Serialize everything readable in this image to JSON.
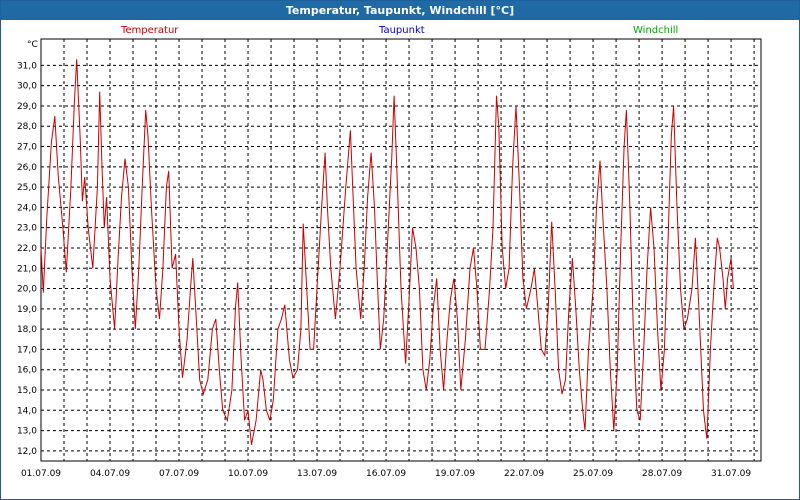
{
  "window": {
    "title": "Temperatur, Taupunkt, Windchill [°C]"
  },
  "colors": {
    "titlebar": "#1f6aa5",
    "temperatur": "#cc0000",
    "taupunkt": "#0000cc",
    "windchill": "#00aa00",
    "grid": "#000000"
  },
  "chart_data": {
    "type": "line",
    "title": "Temperatur, Taupunkt, Windchill [°C]",
    "ylabel": "°C",
    "xlabel": "",
    "ylim": [
      11.5,
      32.3
    ],
    "xlim": [
      0,
      31.3
    ],
    "grid": true,
    "legend_placement": "top",
    "legend": [
      "Temperatur",
      "Taupunkt",
      "Windchill"
    ],
    "y_ticks": [
      "12,0",
      "13,0",
      "14,0",
      "15,0",
      "16,0",
      "17,0",
      "18,0",
      "19,0",
      "20,0",
      "21,0",
      "22,0",
      "23,0",
      "24,0",
      "25,0",
      "26,0",
      "27,0",
      "28,0",
      "29,0",
      "30,0",
      "31,0"
    ],
    "x_ticks": [
      {
        "day": 0,
        "label": "01.07.09"
      },
      {
        "day": 3,
        "label": "04.07.09"
      },
      {
        "day": 6,
        "label": "07.07.09"
      },
      {
        "day": 9,
        "label": "10.07.09"
      },
      {
        "day": 12,
        "label": "13.07.09"
      },
      {
        "day": 15,
        "label": "16.07.09"
      },
      {
        "day": 18,
        "label": "19.07.09"
      },
      {
        "day": 21,
        "label": "22.07.09"
      },
      {
        "day": 24,
        "label": "25.07.09"
      },
      {
        "day": 27,
        "label": "28.07.09"
      },
      {
        "day": 30,
        "label": "31.07.09"
      }
    ],
    "series": [
      {
        "name": "Temperatur",
        "points": [
          [
            0.0,
            22.0
          ],
          [
            0.1,
            19.8
          ],
          [
            0.25,
            23.5
          ],
          [
            0.45,
            27.2
          ],
          [
            0.6,
            28.5
          ],
          [
            0.75,
            25.5
          ],
          [
            0.95,
            23.0
          ],
          [
            1.1,
            20.8
          ],
          [
            1.3,
            25.0
          ],
          [
            1.45,
            29.2
          ],
          [
            1.55,
            31.3
          ],
          [
            1.7,
            27.5
          ],
          [
            1.8,
            24.3
          ],
          [
            1.9,
            25.5
          ],
          [
            2.05,
            23.0
          ],
          [
            2.25,
            21.0
          ],
          [
            2.45,
            25.0
          ],
          [
            2.55,
            29.7
          ],
          [
            2.65,
            26.0
          ],
          [
            2.75,
            23.0
          ],
          [
            2.85,
            24.5
          ],
          [
            3.0,
            20.5
          ],
          [
            3.2,
            18.0
          ],
          [
            3.35,
            21.5
          ],
          [
            3.5,
            24.5
          ],
          [
            3.65,
            26.4
          ],
          [
            3.8,
            25.0
          ],
          [
            3.95,
            21.0
          ],
          [
            4.1,
            18.0
          ],
          [
            4.25,
            21.0
          ],
          [
            4.4,
            25.0
          ],
          [
            4.55,
            28.8
          ],
          [
            4.65,
            27.5
          ],
          [
            4.8,
            24.0
          ],
          [
            5.0,
            20.0
          ],
          [
            5.15,
            18.5
          ],
          [
            5.3,
            21.0
          ],
          [
            5.45,
            25.0
          ],
          [
            5.55,
            25.8
          ],
          [
            5.7,
            21.0
          ],
          [
            5.85,
            21.7
          ],
          [
            6.0,
            18.0
          ],
          [
            6.15,
            15.6
          ],
          [
            6.35,
            17.5
          ],
          [
            6.5,
            20.0
          ],
          [
            6.6,
            21.5
          ],
          [
            6.75,
            18.5
          ],
          [
            6.9,
            15.5
          ],
          [
            7.05,
            14.8
          ],
          [
            7.25,
            15.5
          ],
          [
            7.45,
            18.0
          ],
          [
            7.6,
            18.5
          ],
          [
            7.75,
            16.0
          ],
          [
            7.9,
            14.0
          ],
          [
            8.1,
            13.5
          ],
          [
            8.3,
            15.0
          ],
          [
            8.45,
            19.0
          ],
          [
            8.55,
            20.3
          ],
          [
            8.7,
            16.5
          ],
          [
            8.85,
            13.5
          ],
          [
            9.0,
            14.0
          ],
          [
            9.15,
            12.3
          ],
          [
            9.35,
            13.5
          ],
          [
            9.55,
            16.0
          ],
          [
            9.65,
            15.5
          ],
          [
            9.8,
            14.0
          ],
          [
            9.95,
            13.5
          ],
          [
            10.1,
            14.5
          ],
          [
            10.3,
            18.0
          ],
          [
            10.45,
            18.5
          ],
          [
            10.6,
            19.2
          ],
          [
            10.8,
            16.5
          ],
          [
            10.95,
            15.6
          ],
          [
            11.15,
            16.0
          ],
          [
            11.3,
            18.0
          ],
          [
            11.4,
            23.2
          ],
          [
            11.55,
            20.0
          ],
          [
            11.7,
            17.0
          ],
          [
            11.85,
            17.0
          ],
          [
            12.0,
            20.0
          ],
          [
            12.2,
            24.0
          ],
          [
            12.35,
            26.7
          ],
          [
            12.45,
            24.0
          ],
          [
            12.6,
            21.0
          ],
          [
            12.8,
            18.5
          ],
          [
            13.0,
            21.0
          ],
          [
            13.25,
            25.0
          ],
          [
            13.45,
            27.8
          ],
          [
            13.55,
            25.0
          ],
          [
            13.7,
            21.0
          ],
          [
            13.9,
            18.5
          ],
          [
            14.05,
            21.0
          ],
          [
            14.2,
            24.5
          ],
          [
            14.35,
            26.7
          ],
          [
            14.5,
            24.0
          ],
          [
            14.6,
            21.0
          ],
          [
            14.75,
            17.0
          ],
          [
            14.9,
            18.5
          ],
          [
            15.1,
            23.0
          ],
          [
            15.25,
            26.5
          ],
          [
            15.35,
            29.5
          ],
          [
            15.5,
            25.0
          ],
          [
            15.65,
            20.0
          ],
          [
            15.85,
            16.3
          ],
          [
            16.0,
            19.5
          ],
          [
            16.15,
            23.0
          ],
          [
            16.3,
            22.0
          ],
          [
            16.45,
            20.0
          ],
          [
            16.6,
            16.0
          ],
          [
            16.75,
            15.0
          ],
          [
            16.9,
            16.5
          ],
          [
            17.05,
            19.0
          ],
          [
            17.2,
            20.5
          ],
          [
            17.35,
            17.0
          ],
          [
            17.5,
            15.0
          ],
          [
            17.65,
            17.5
          ],
          [
            17.8,
            19.5
          ],
          [
            17.95,
            20.5
          ],
          [
            18.1,
            18.5
          ],
          [
            18.25,
            15.0
          ],
          [
            18.45,
            17.5
          ],
          [
            18.65,
            21.0
          ],
          [
            18.8,
            22.0
          ],
          [
            18.95,
            20.0
          ],
          [
            19.1,
            17.0
          ],
          [
            19.3,
            17.0
          ],
          [
            19.5,
            20.0
          ],
          [
            19.65,
            23.0
          ],
          [
            19.8,
            29.5
          ],
          [
            19.9,
            28.0
          ],
          [
            20.05,
            22.0
          ],
          [
            20.2,
            20.0
          ],
          [
            20.35,
            21.0
          ],
          [
            20.5,
            26.0
          ],
          [
            20.65,
            29.0
          ],
          [
            20.8,
            25.0
          ],
          [
            20.95,
            20.5
          ],
          [
            21.1,
            19.0
          ],
          [
            21.3,
            20.0
          ],
          [
            21.45,
            21.0
          ],
          [
            21.6,
            19.0
          ],
          [
            21.75,
            17.0
          ],
          [
            21.9,
            16.7
          ],
          [
            22.05,
            19.0
          ],
          [
            22.2,
            23.3
          ],
          [
            22.35,
            20.0
          ],
          [
            22.5,
            16.0
          ],
          [
            22.65,
            14.8
          ],
          [
            22.8,
            15.5
          ],
          [
            22.95,
            19.0
          ],
          [
            23.1,
            21.5
          ],
          [
            23.25,
            19.0
          ],
          [
            23.4,
            16.0
          ],
          [
            23.55,
            14.0
          ],
          [
            23.65,
            13.0
          ],
          [
            23.8,
            17.0
          ],
          [
            24.0,
            20.0
          ],
          [
            24.15,
            24.0
          ],
          [
            24.3,
            26.3
          ],
          [
            24.45,
            23.0
          ],
          [
            24.6,
            20.0
          ],
          [
            24.75,
            16.0
          ],
          [
            24.9,
            13.0
          ],
          [
            25.05,
            16.0
          ],
          [
            25.2,
            22.0
          ],
          [
            25.35,
            27.0
          ],
          [
            25.45,
            28.8
          ],
          [
            25.6,
            24.0
          ],
          [
            25.75,
            18.0
          ],
          [
            25.9,
            14.0
          ],
          [
            26.05,
            13.5
          ],
          [
            26.2,
            17.0
          ],
          [
            26.35,
            21.0
          ],
          [
            26.5,
            24.0
          ],
          [
            26.65,
            22.0
          ],
          [
            26.8,
            18.0
          ],
          [
            26.95,
            15.0
          ],
          [
            27.1,
            17.0
          ],
          [
            27.25,
            22.0
          ],
          [
            27.4,
            27.5
          ],
          [
            27.5,
            29.0
          ],
          [
            27.65,
            24.0
          ],
          [
            27.8,
            20.0
          ],
          [
            27.95,
            18.0
          ],
          [
            28.1,
            18.5
          ],
          [
            28.3,
            20.0
          ],
          [
            28.45,
            22.5
          ],
          [
            28.6,
            19.0
          ],
          [
            28.8,
            14.0
          ],
          [
            28.9,
            13.0
          ],
          [
            28.95,
            12.6
          ],
          [
            29.1,
            17.0
          ],
          [
            29.25,
            20.0
          ],
          [
            29.4,
            22.5
          ],
          [
            29.5,
            22.0
          ],
          [
            29.65,
            20.5
          ],
          [
            29.75,
            19.0
          ],
          [
            29.85,
            20.5
          ],
          [
            30.0,
            21.5
          ],
          [
            30.1,
            20.0
          ]
        ]
      }
    ]
  }
}
